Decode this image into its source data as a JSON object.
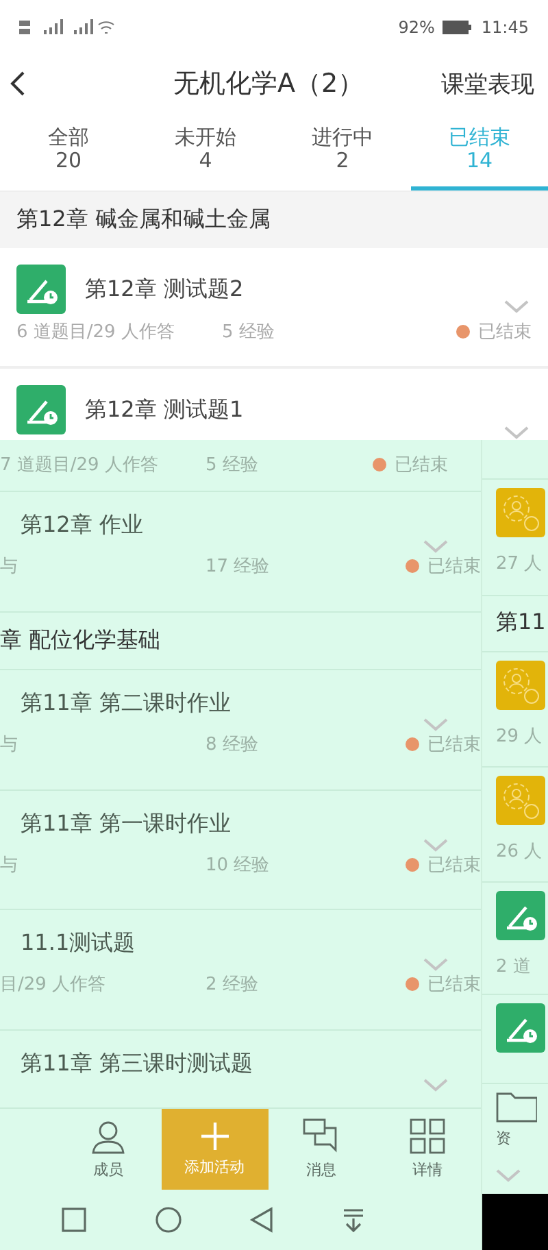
{
  "status_bar": {
    "battery": "92%",
    "time": "11:45"
  },
  "header": {
    "title": "无机化学A（2）",
    "action": "课堂表现"
  },
  "tabs": [
    {
      "label": "全部",
      "count": "20",
      "selected": false
    },
    {
      "label": "未开始",
      "count": "4",
      "selected": false
    },
    {
      "label": "进行中",
      "count": "2",
      "selected": false
    },
    {
      "label": "已结束",
      "count": "14",
      "selected": true
    }
  ],
  "top_list": {
    "chapter": "第12章 碱金属和碱土金属",
    "items": [
      {
        "kind": "test",
        "title": "第12章 测试题2",
        "info": "6 道题目/29 人作答",
        "exp": "5 经验",
        "status": "已结束",
        "color": "#e8956a"
      },
      {
        "kind": "test",
        "title": "第12章 测试题1"
      }
    ]
  },
  "lower_list": [
    {
      "kind": "meta",
      "info": "7 道题目/29 人作答",
      "exp": "5 经验",
      "status": "已结束",
      "color": "#e8956a"
    },
    {
      "kind": "activity",
      "title": "第12章 作业",
      "info": "与",
      "exp": "17 经验",
      "status": "已结束",
      "color": "#e8956a"
    },
    {
      "kind": "chapter",
      "title": "章 配位化学基础"
    },
    {
      "kind": "activity",
      "title": "第11章 第二课时作业",
      "info": "与",
      "exp": "8 经验",
      "status": "已结束",
      "color": "#e8956a"
    },
    {
      "kind": "activity",
      "title": "第11章 第一课时作业",
      "info": "与",
      "exp": "10 经验",
      "status": "已结束",
      "color": "#e8956a"
    },
    {
      "kind": "activity",
      "title": "11.1测试题",
      "info": "目/29 人作答",
      "exp": "2 经验",
      "status": "已结束",
      "color": "#e8956a"
    },
    {
      "kind": "activity",
      "title": "第11章 第三课时测试题"
    }
  ],
  "side_strip": [
    {
      "kind": "group",
      "text": "27 人"
    },
    {
      "kind": "chapter",
      "text": "第11"
    },
    {
      "kind": "group",
      "text": "29 人"
    },
    {
      "kind": "group",
      "text": "26 人"
    },
    {
      "kind": "test",
      "text": "2 道"
    },
    {
      "kind": "test"
    },
    {
      "kind": "resource",
      "text": "资"
    }
  ],
  "bottom_nav": [
    {
      "kind": "member",
      "label": "成员"
    },
    {
      "kind": "add",
      "label": "添加活动"
    },
    {
      "kind": "message",
      "label": "消息"
    },
    {
      "kind": "detail",
      "label": "详情"
    }
  ]
}
